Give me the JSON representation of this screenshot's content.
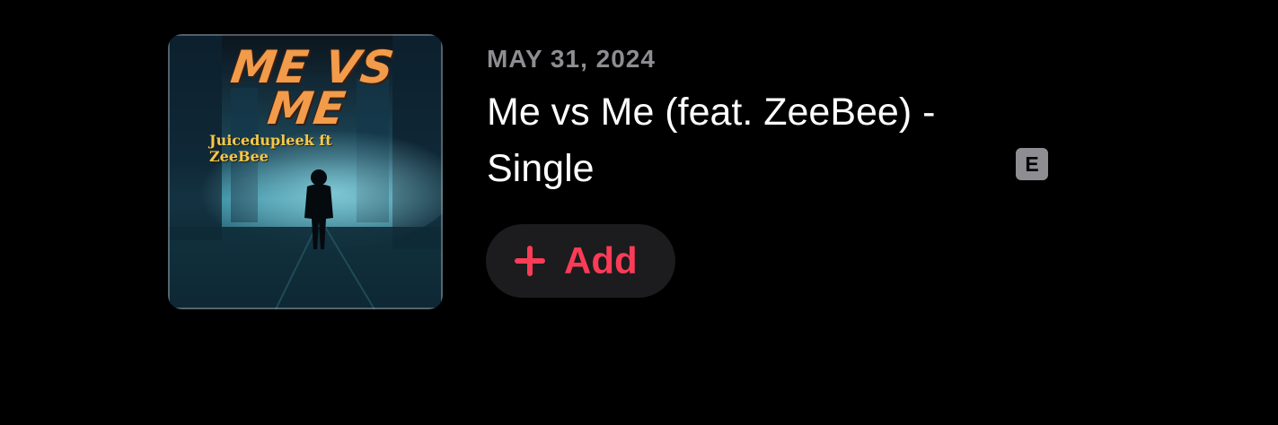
{
  "album": {
    "release_date": "MAY 31, 2024",
    "title": "Me vs Me (feat. ZeeBee) - Single",
    "explicit_badge": "E",
    "add_label": "Add",
    "artwork": {
      "title_text": "ME VS ME",
      "artist_line_1": "Juicedupleek ft",
      "artist_line_2": "ZeeBee"
    }
  },
  "colors": {
    "background": "#000000",
    "accent": "#fa3c57",
    "secondary_text": "#8d8d92",
    "button_bg": "#1c1c1e"
  },
  "icons": {
    "add": "plus-icon",
    "explicit": "explicit-badge"
  }
}
